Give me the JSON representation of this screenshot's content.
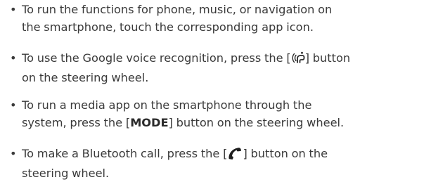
{
  "bullet_glyph": "•",
  "items": [
    {
      "line1": "To run the functions for phone, music, or navigation on",
      "line2": "the smartphone, touch the corresponding app icon."
    },
    {
      "line1_before": "To use the Google voice recognition, press the [",
      "line1_icon": "voice-recognition-icon",
      "line1_after": "] button",
      "line2": "on the steering wheel."
    },
    {
      "line1": "To run a media app on the smartphone through the",
      "line2_before": "system, press the [",
      "line2_bold": "MODE",
      "line2_after": "] button on the steering wheel."
    },
    {
      "line1_before": "To make a Bluetooth call, press the [",
      "line1_icon": "phone-call-icon",
      "line1_after": "] button on the",
      "line2": "steering wheel."
    }
  ],
  "colors": {
    "text": "#3a3a3a",
    "background": "#ffffff"
  }
}
